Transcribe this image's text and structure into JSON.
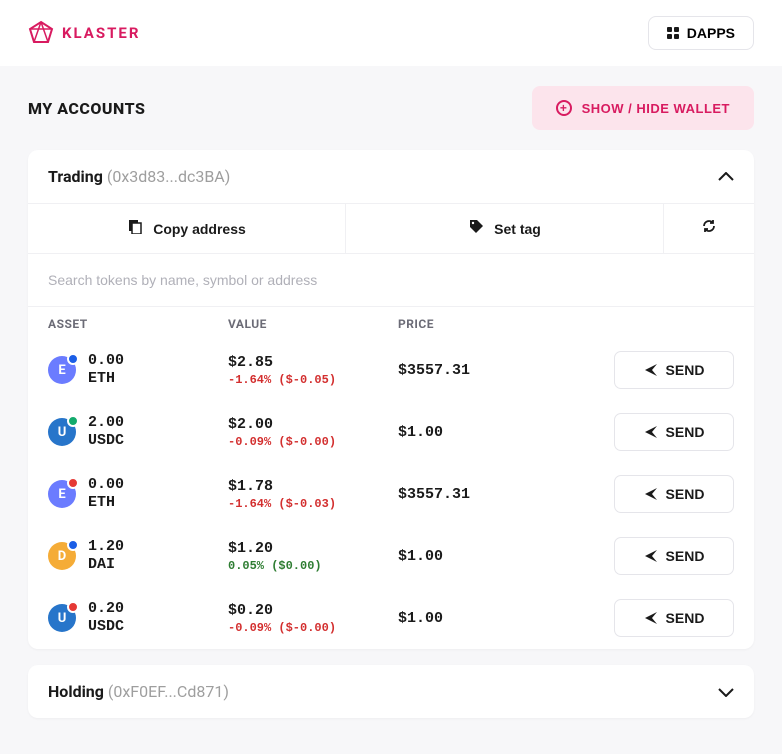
{
  "header": {
    "brand": "KLASTER",
    "dapps": "DAPPS"
  },
  "page": {
    "title": "MY ACCOUNTS",
    "show_hide": "SHOW / HIDE WALLET"
  },
  "accounts": [
    {
      "name": "Trading",
      "addr": "(0x3d83...dc3BA)",
      "copy_label": "Copy address",
      "tag_label": "Set tag",
      "search_placeholder": "Search tokens by name, symbol or address",
      "columns": {
        "asset": "ASSET",
        "value": "VALUE",
        "price": "PRICE"
      },
      "assets": [
        {
          "amount": "0.00",
          "symbol": "ETH",
          "value": "$2.85",
          "change": "-1.64% ($-0.05)",
          "change_dir": "neg",
          "price": "$3557.31",
          "send": "SEND",
          "icon_bg": "#6b7cff",
          "badge_bg": "#1b5ee6"
        },
        {
          "amount": "2.00",
          "symbol": "USDC",
          "value": "$2.00",
          "change": "-0.09% ($-0.00)",
          "change_dir": "neg",
          "price": "$1.00",
          "send": "SEND",
          "icon_bg": "#2775ca",
          "badge_bg": "#13aa6c"
        },
        {
          "amount": "0.00",
          "symbol": "ETH",
          "value": "$1.78",
          "change": "-1.64% ($-0.03)",
          "change_dir": "neg",
          "price": "$3557.31",
          "send": "SEND",
          "icon_bg": "#6b7cff",
          "badge_bg": "#e53935"
        },
        {
          "amount": "1.20",
          "symbol": "DAI",
          "value": "$1.20",
          "change": "0.05% ($0.00)",
          "change_dir": "pos",
          "price": "$1.00",
          "send": "SEND",
          "icon_bg": "#f5ac37",
          "badge_bg": "#1b5ee6"
        },
        {
          "amount": "0.20",
          "symbol": "USDC",
          "value": "$0.20",
          "change": "-0.09% ($-0.00)",
          "change_dir": "neg",
          "price": "$1.00",
          "send": "SEND",
          "icon_bg": "#2775ca",
          "badge_bg": "#e53935"
        }
      ]
    },
    {
      "name": "Holding",
      "addr": "(0xF0EF...Cd871)"
    }
  ]
}
